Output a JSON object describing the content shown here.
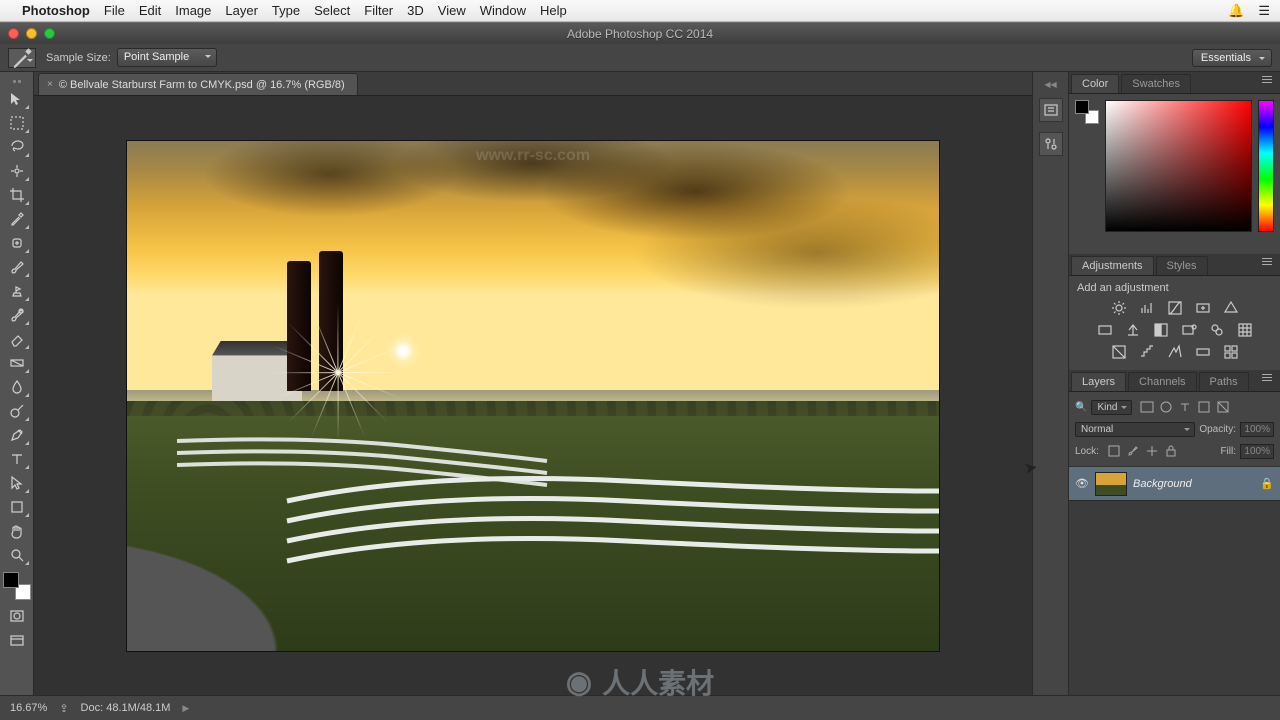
{
  "mac_menu": {
    "app": "Photoshop",
    "items": [
      "File",
      "Edit",
      "Image",
      "Layer",
      "Type",
      "Select",
      "Filter",
      "3D",
      "View",
      "Window",
      "Help"
    ]
  },
  "window_title": "Adobe Photoshop CC 2014",
  "options_bar": {
    "sample_size_label": "Sample Size:",
    "sample_size_value": "Point Sample"
  },
  "workspace": "Essentials",
  "doc_tab": "© Bellvale Starburst Farm to CMYK.psd @ 16.7% (RGB/8)",
  "status": {
    "zoom": "16.67%",
    "doc": "Doc: 48.1M/48.1M"
  },
  "panels": {
    "color_tabs": [
      "Color",
      "Swatches"
    ],
    "adjustments_tabs": [
      "Adjustments",
      "Styles"
    ],
    "adjustments_hint": "Add an adjustment",
    "layers_tabs": [
      "Layers",
      "Channels",
      "Paths"
    ],
    "layers": {
      "kind_label": "Kind",
      "blend_mode": "Normal",
      "opacity_label": "Opacity:",
      "opacity_value": "100%",
      "lock_label": "Lock:",
      "fill_label": "Fill:",
      "fill_value": "100%",
      "items": [
        {
          "name": "Background",
          "locked": true
        }
      ]
    }
  },
  "watermark": {
    "url": "www.rr-sc.com",
    "brand": "人人素材"
  }
}
